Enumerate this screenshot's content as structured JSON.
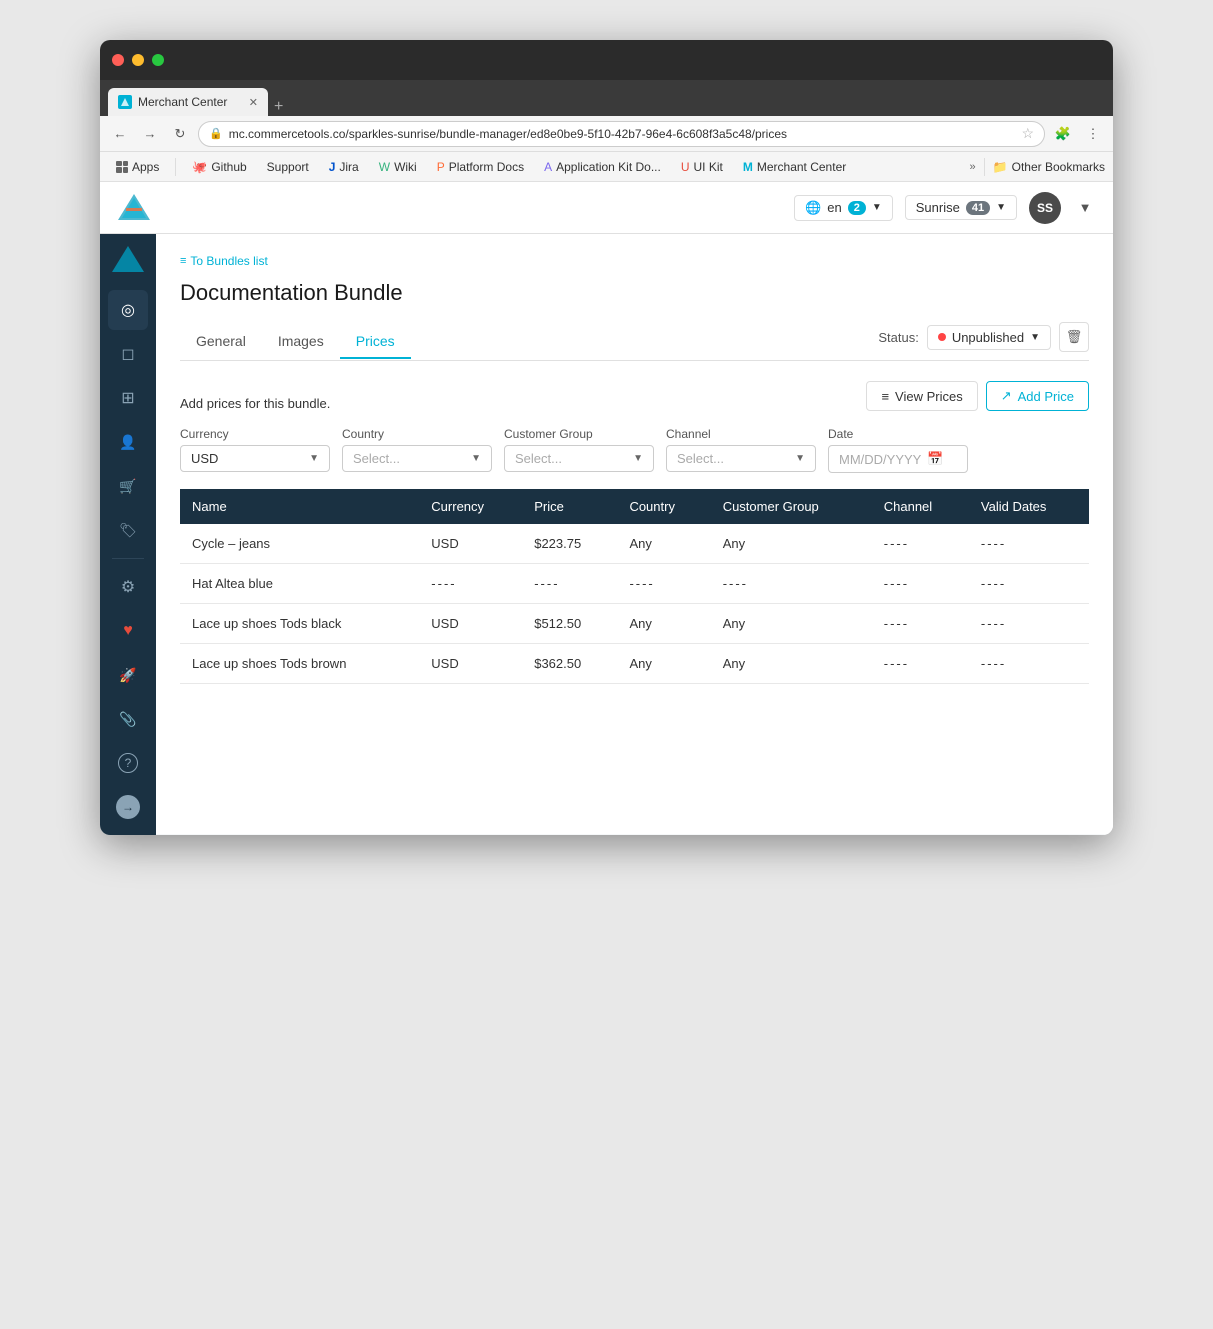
{
  "browser": {
    "tab_title": "Merchant Center",
    "tab_favicon_color": "#00b2d5",
    "url": "mc.commercetools.co/sparkles-sunrise/bundle-manager/ed8e0be9-5f10-42b7-96e4-6c608f3a5c48/prices",
    "bookmarks": [
      {
        "id": "apps",
        "label": "Apps",
        "icon": "apps-grid"
      },
      {
        "id": "github",
        "label": "Github",
        "icon": "github"
      },
      {
        "id": "support",
        "label": "Support",
        "icon": "none"
      },
      {
        "id": "jira",
        "label": "Jira",
        "icon": "jira"
      },
      {
        "id": "wiki",
        "label": "Wiki",
        "icon": "wiki"
      },
      {
        "id": "platform-docs",
        "label": "Platform Docs",
        "icon": "platform"
      },
      {
        "id": "app-kit",
        "label": "Application Kit Do...",
        "icon": "app-kit"
      },
      {
        "id": "ui-kit",
        "label": "UI Kit",
        "icon": "ui-kit"
      },
      {
        "id": "merchant-center",
        "label": "Merchant Center",
        "icon": "mc"
      }
    ],
    "more_label": "»",
    "other_bookmarks": "Other Bookmarks"
  },
  "header": {
    "lang": "en",
    "lang_badge": "2",
    "project": "Sunrise",
    "project_badge": "41",
    "avatar_initials": "SS"
  },
  "sidebar": {
    "items": [
      {
        "id": "dashboard",
        "icon": "⊙"
      },
      {
        "id": "products",
        "icon": "◻"
      },
      {
        "id": "customize",
        "icon": "⊞"
      },
      {
        "id": "customers",
        "icon": "👤"
      },
      {
        "id": "orders",
        "icon": "🛒"
      },
      {
        "id": "marketing",
        "icon": "🏷"
      },
      {
        "id": "settings",
        "icon": "⚙"
      },
      {
        "id": "heart",
        "icon": "♥"
      },
      {
        "id": "launch",
        "icon": "🚀"
      },
      {
        "id": "paperclip",
        "icon": "📎"
      }
    ],
    "bottom_items": [
      {
        "id": "help",
        "icon": "?"
      },
      {
        "id": "forward",
        "icon": "→"
      }
    ]
  },
  "breadcrumb": {
    "icon": "≡",
    "label": "To Bundles list"
  },
  "page": {
    "title": "Documentation Bundle",
    "tabs": [
      {
        "id": "general",
        "label": "General",
        "active": false
      },
      {
        "id": "images",
        "label": "Images",
        "active": false
      },
      {
        "id": "prices",
        "label": "Prices",
        "active": true
      }
    ],
    "status_label": "Status:",
    "status_value": "Unpublished",
    "filter_description": "Add prices for this bundle.",
    "view_prices_label": "View Prices",
    "add_price_label": "Add Price"
  },
  "filters": {
    "currency": {
      "label": "Currency",
      "value": "USD"
    },
    "country": {
      "label": "Country",
      "placeholder": "Select..."
    },
    "customer_group": {
      "label": "Customer Group",
      "placeholder": "Select..."
    },
    "channel": {
      "label": "Channel",
      "placeholder": "Select..."
    },
    "date": {
      "label": "Date",
      "placeholder": "MM/DD/YYYY"
    }
  },
  "table": {
    "columns": [
      {
        "id": "name",
        "label": "Name"
      },
      {
        "id": "currency",
        "label": "Currency"
      },
      {
        "id": "price",
        "label": "Price"
      },
      {
        "id": "country",
        "label": "Country"
      },
      {
        "id": "customer_group",
        "label": "Customer Group"
      },
      {
        "id": "channel",
        "label": "Channel"
      },
      {
        "id": "valid_dates",
        "label": "Valid Dates"
      }
    ],
    "rows": [
      {
        "name": "Cycle – jeans",
        "currency": "USD",
        "price": "$223.75",
        "country": "Any",
        "customer_group": "Any",
        "channel": "----",
        "valid_dates": "----"
      },
      {
        "name": "Hat Altea blue",
        "currency": "----",
        "price": "----",
        "country": "----",
        "customer_group": "----",
        "channel": "----",
        "valid_dates": "----"
      },
      {
        "name": "Lace up shoes Tods black",
        "currency": "USD",
        "price": "$512.50",
        "country": "Any",
        "customer_group": "Any",
        "channel": "----",
        "valid_dates": "----"
      },
      {
        "name": "Lace up shoes Tods brown",
        "currency": "USD",
        "price": "$362.50",
        "country": "Any",
        "customer_group": "Any",
        "channel": "----",
        "valid_dates": "----"
      }
    ]
  },
  "colors": {
    "sidebar_bg": "#1a3142",
    "header_accent": "#00b2d5",
    "table_header_bg": "#1a3142",
    "status_unpublished": "#ff4444",
    "tab_active": "#00b2d5",
    "breadcrumb": "#00b2d5"
  }
}
